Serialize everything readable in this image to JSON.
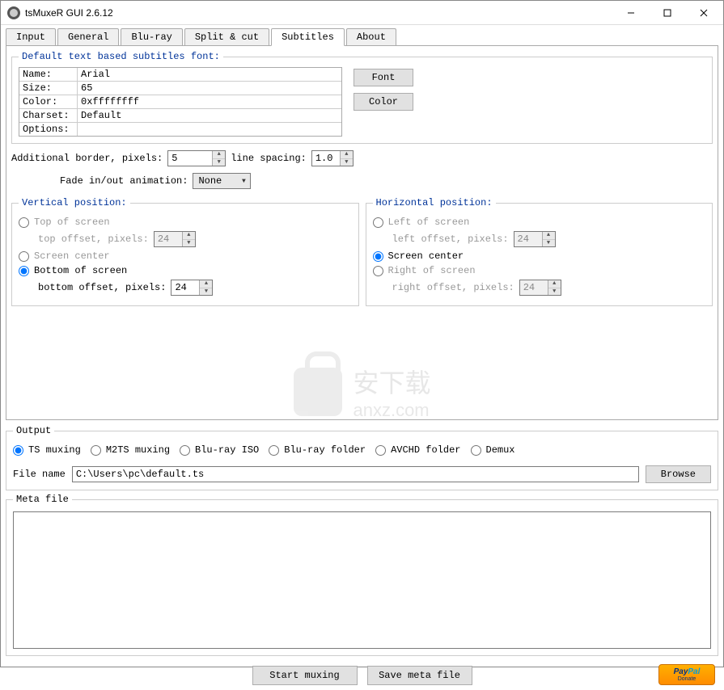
{
  "window": {
    "title": "tsMuxeR GUI 2.6.12"
  },
  "tabs": {
    "items": [
      "Input",
      "General",
      "Blu-ray",
      "Split & cut",
      "Subtitles",
      "About"
    ],
    "active": 4
  },
  "subtitle_panel": {
    "font_group_label": "Default text based subtitles font:",
    "font_table": {
      "rows": [
        {
          "key": "Name:",
          "val": "Arial"
        },
        {
          "key": "Size:",
          "val": "65"
        },
        {
          "key": "Color:",
          "val": "0xffffffff"
        },
        {
          "key": "Charset:",
          "val": "Default"
        },
        {
          "key": "Options:",
          "val": ""
        }
      ]
    },
    "font_btn": "Font",
    "color_btn": "Color",
    "additional_border_label": "Additional border, pixels:",
    "additional_border_value": "5",
    "line_spacing_label": "line spacing:",
    "line_spacing_value": "1.0",
    "fade_label": "Fade in/out animation:",
    "fade_value": "None",
    "vertical": {
      "legend": "Vertical position:",
      "top_label": "Top of screen",
      "top_offset_label": "top offset, pixels:",
      "top_offset_value": "24",
      "center_label": "Screen center",
      "bottom_label": "Bottom of screen",
      "bottom_offset_label": "bottom offset, pixels:",
      "bottom_offset_value": "24",
      "selected": "bottom"
    },
    "horizontal": {
      "legend": "Horizontal position:",
      "left_label": "Left of screen",
      "left_offset_label": "left offset, pixels:",
      "left_offset_value": "24",
      "center_label": "Screen center",
      "right_label": "Right of screen",
      "right_offset_label": "right offset, pixels:",
      "right_offset_value": "24",
      "selected": "center"
    }
  },
  "watermark": {
    "text1": "安下载",
    "text2": "anxz.com"
  },
  "output": {
    "legend": "Output",
    "modes": {
      "options": [
        "TS muxing",
        "M2TS muxing",
        "Blu-ray ISO",
        "Blu-ray folder",
        "AVCHD folder",
        "Demux"
      ],
      "selected": 0
    },
    "file_label": "File name",
    "file_value": "C:\\Users\\pc\\default.ts",
    "browse_label": "Browse"
  },
  "meta": {
    "legend": "Meta file"
  },
  "bottom": {
    "start_label": "Start muxing",
    "save_label": "Save meta file",
    "paypal_brand": "PayPal",
    "paypal_sub": "Donate"
  }
}
